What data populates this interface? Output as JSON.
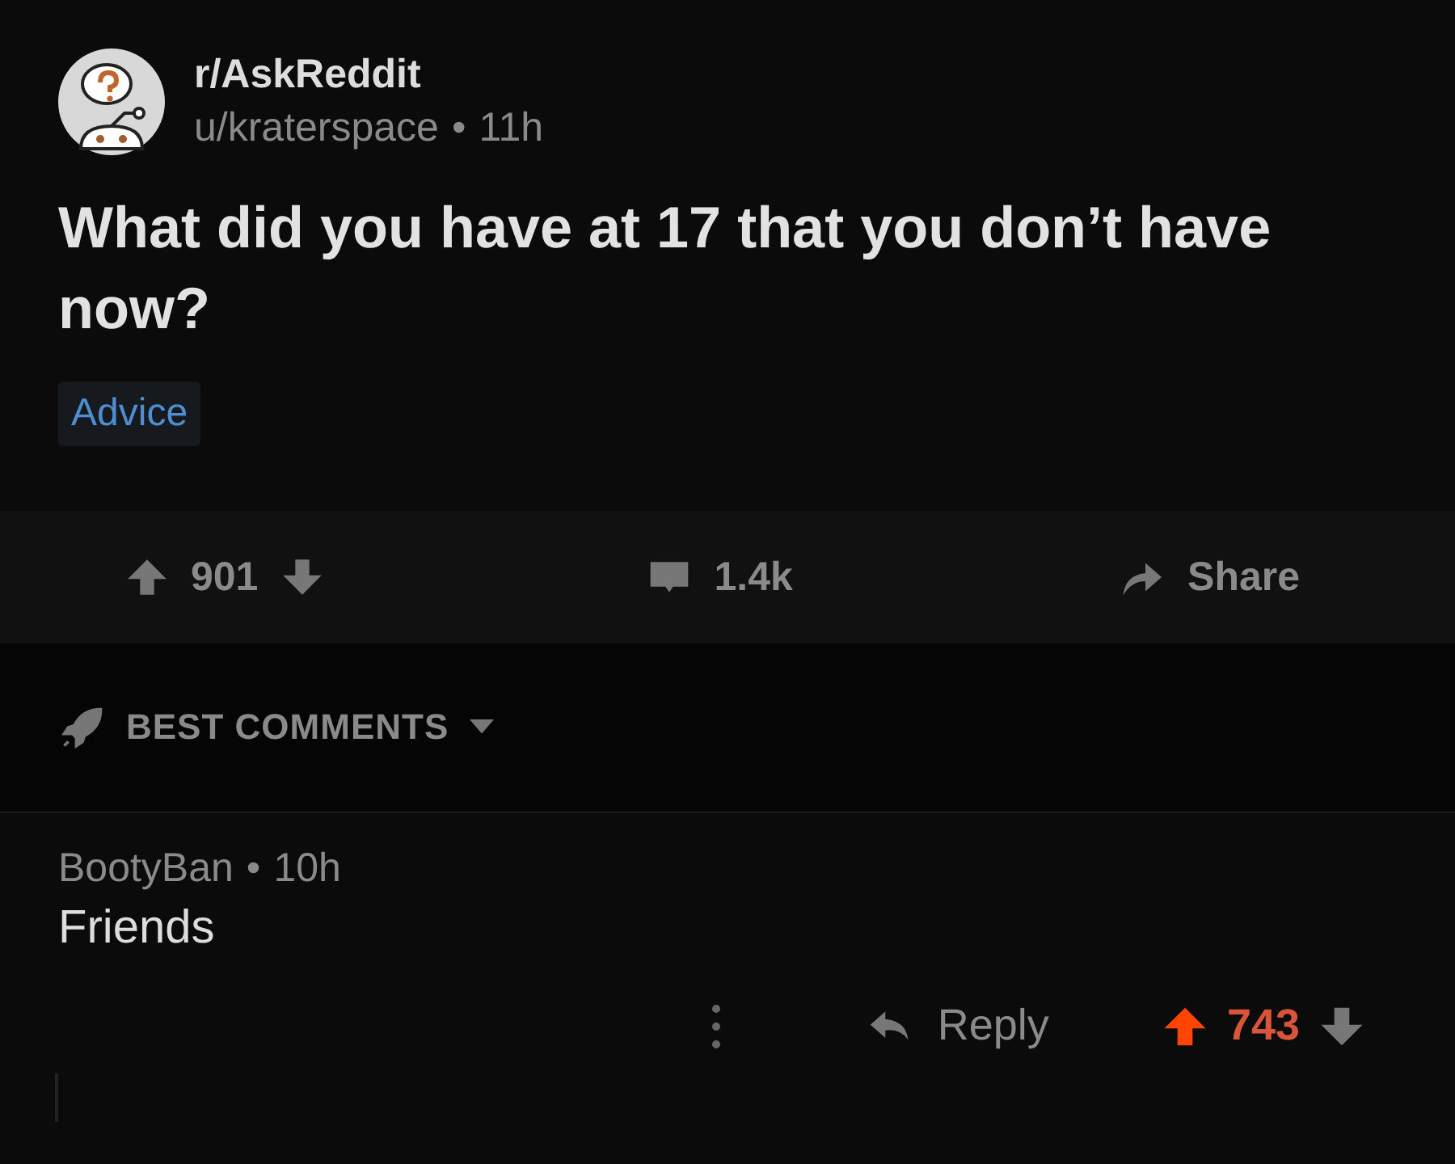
{
  "post": {
    "subreddit": "r/AskReddit",
    "author": "u/kraterspace",
    "separator": "•",
    "age": "11h",
    "title": "What did you have at 17 that you don’t have now?",
    "flair": "Advice",
    "score": "901",
    "upvoted": false,
    "comments": "1.4k",
    "share": "Share"
  },
  "sort": {
    "label": "BEST COMMENTS"
  },
  "comments": [
    {
      "author": "BootyBan",
      "separator": "•",
      "age": "10h",
      "body": "Friends",
      "reply": "Reply",
      "score": "743",
      "upvoted": true
    }
  ]
}
